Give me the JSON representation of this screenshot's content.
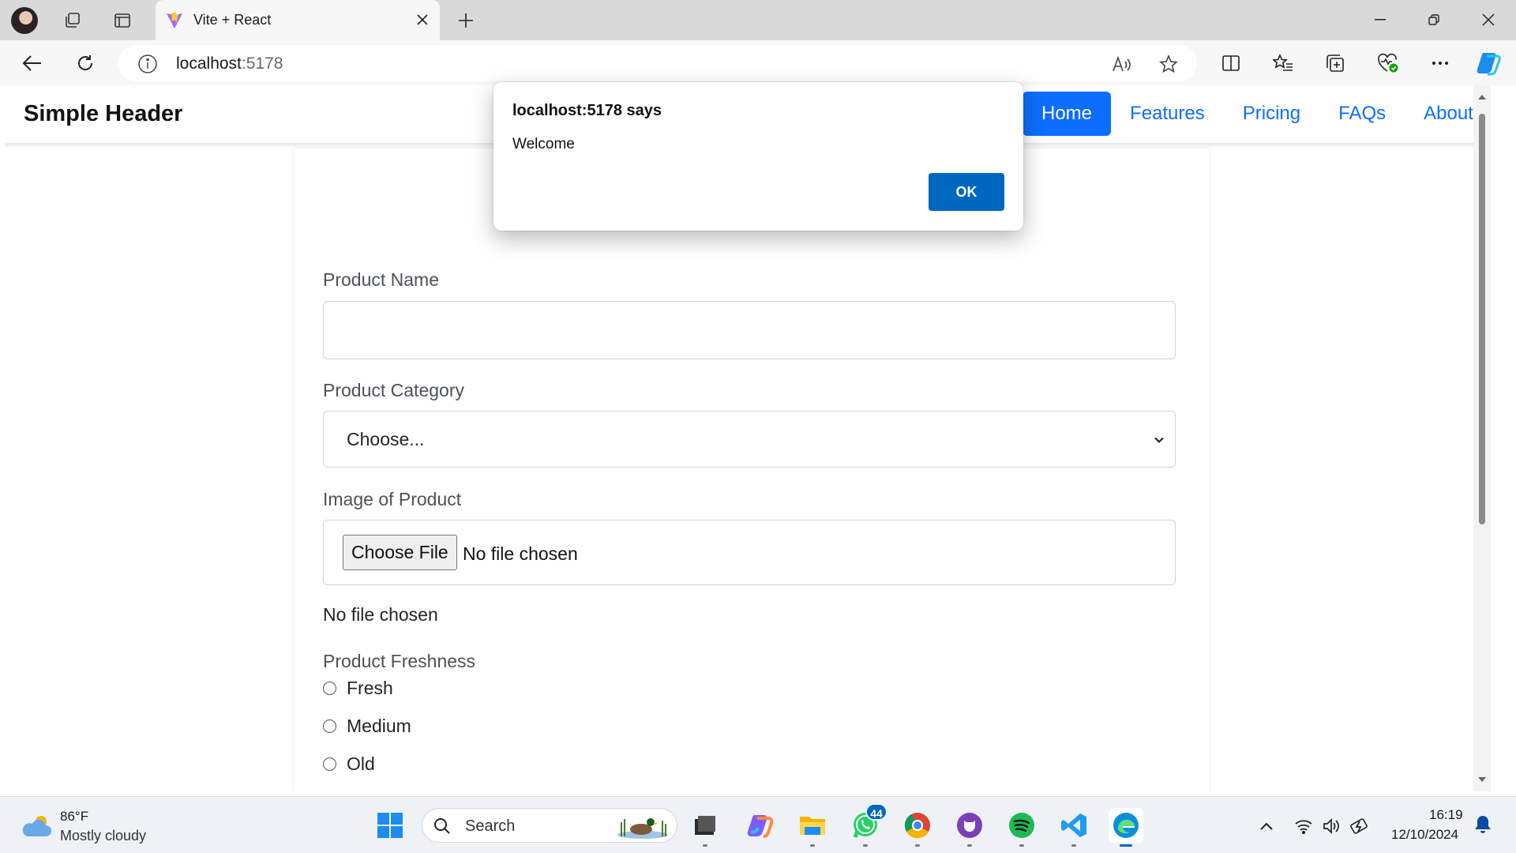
{
  "browser": {
    "tab": {
      "title": "Vite + React"
    },
    "address": {
      "host": "localhost",
      "port": ":5178"
    }
  },
  "site": {
    "brand": "Simple Header",
    "nav": [
      {
        "label": "Home",
        "active": true
      },
      {
        "label": "Features"
      },
      {
        "label": "Pricing"
      },
      {
        "label": "FAQs"
      },
      {
        "label": "About"
      }
    ]
  },
  "form": {
    "product_name": {
      "label": "Product Name",
      "value": ""
    },
    "product_category": {
      "label": "Product Category",
      "selected": "Choose..."
    },
    "image": {
      "label": "Image of Product",
      "button": "Choose File",
      "status": "No file chosen",
      "below_text": "No file chosen"
    },
    "freshness": {
      "label": "Product Freshness",
      "options": [
        "Fresh",
        "Medium",
        "Old"
      ]
    }
  },
  "dialog": {
    "title": "localhost:5178 says",
    "message": "Welcome",
    "ok_label": "OK"
  },
  "taskbar": {
    "weather": {
      "temp": "86°F",
      "desc": "Mostly cloudy"
    },
    "search_placeholder": "Search",
    "whatsapp_badge": "44",
    "clock": {
      "time": "16:19",
      "date": "12/10/2024"
    }
  },
  "colors": {
    "accent": "#0d6efd",
    "dialog_ok": "#0067c0",
    "taskbar": "#eef2f7"
  }
}
